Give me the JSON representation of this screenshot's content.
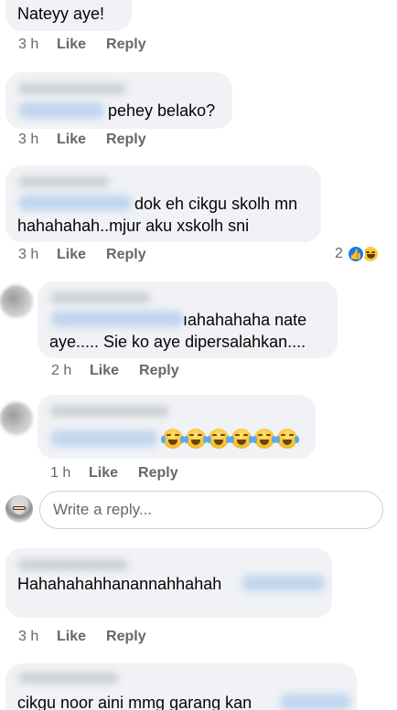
{
  "comments": [
    {
      "text_lines": [
        "Nateyy aye!"
      ],
      "time": "3 h",
      "like": "Like",
      "reply": "Reply"
    },
    {
      "text_lines": [
        "pehey belako?"
      ],
      "time": "3 h",
      "like": "Like",
      "reply": "Reply"
    },
    {
      "text_lines": [
        "dok eh cikgu skolh mn",
        "hahahahah..mjur aku xskolh sni"
      ],
      "time": "3 h",
      "like": "Like",
      "reply": "Reply",
      "reaction_count": "2"
    },
    {
      "text_lines": [
        "ıahahahaha nate",
        "aye..... Sie ko aye dipersalahkan...."
      ],
      "time": "2 h",
      "like": "Like",
      "reply": "Reply"
    },
    {
      "emoji": "tears-of-joy x6",
      "time": "1 h",
      "like": "Like",
      "reply": "Reply"
    },
    {
      "text_lines": [
        "Hahahahahhanannahhahah"
      ],
      "time": "3 h",
      "like": "Like",
      "reply": "Reply"
    },
    {
      "text_lines": [
        "cikgu noor aini  mmg garang kan"
      ]
    }
  ],
  "reply_box": {
    "placeholder": "Write a reply..."
  },
  "colors": {
    "bubble": "#f0f2f5",
    "meta_text": "#65676b",
    "mention": "#bcd3ee",
    "like_reaction": "#1877f2",
    "haha_reaction": "#f7c940"
  },
  "icons": [
    "like-reaction-icon",
    "haha-reaction-icon",
    "tears-of-joy-emoji",
    "user-avatar"
  ]
}
